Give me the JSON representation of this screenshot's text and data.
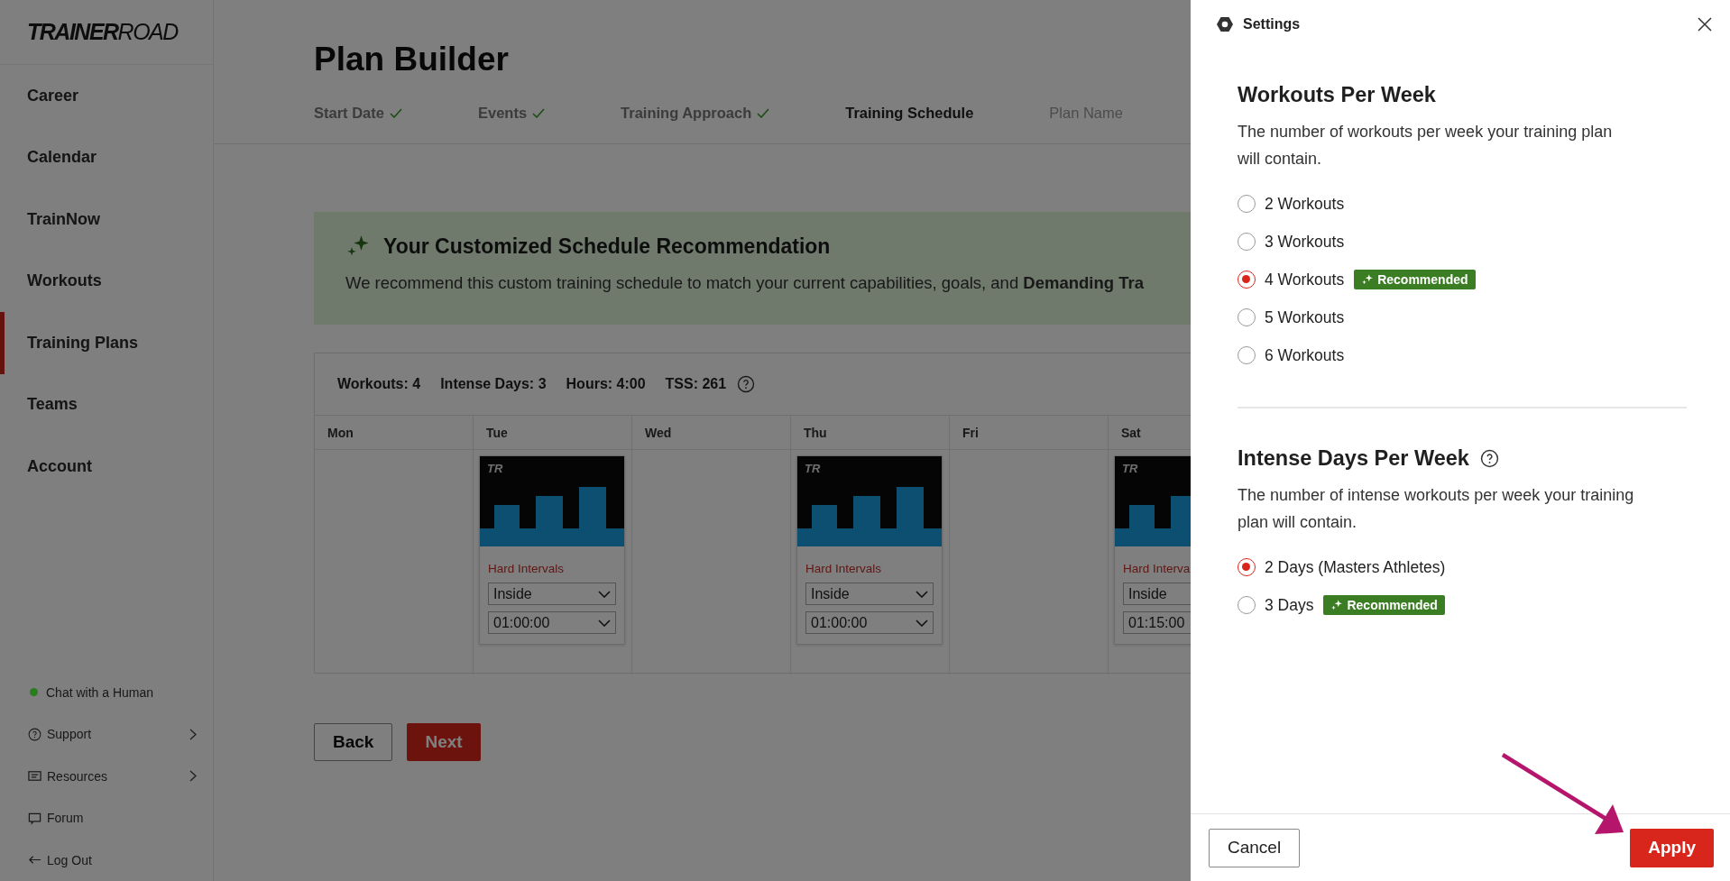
{
  "sidebar": {
    "logo": "**TRAINER**ROAD",
    "nav": [
      {
        "label": "Career",
        "selected": false
      },
      {
        "label": "Calendar",
        "selected": false
      },
      {
        "label": "TrainNow",
        "selected": false
      },
      {
        "label": "Workouts",
        "selected": false
      },
      {
        "label": "Training Plans",
        "selected": true
      },
      {
        "label": "Teams",
        "selected": false
      },
      {
        "label": "Account",
        "selected": false
      }
    ],
    "footer_links": [
      {
        "kind": "status",
        "label": "Chat with a Human",
        "color": "#2a7d1e",
        "has_submenu": false
      },
      {
        "kind": "help",
        "label": "Support",
        "has_submenu": true
      },
      {
        "kind": "resources",
        "label": "Resources",
        "has_submenu": true
      },
      {
        "kind": "forum",
        "label": "Forum",
        "has_submenu": false
      },
      {
        "kind": "logout",
        "label": "Log Out",
        "has_submenu": false
      }
    ]
  },
  "page": {
    "title": "Plan Builder",
    "steps": [
      {
        "label": "Start Date",
        "done": true,
        "selected": false
      },
      {
        "label": "Events",
        "done": true,
        "selected": false
      },
      {
        "label": "Training Approach",
        "done": true,
        "selected": false
      },
      {
        "label": "Training Schedule",
        "done": false,
        "selected": true
      },
      {
        "label": "Plan Name",
        "done": false,
        "selected": false
      }
    ],
    "banner": {
      "title": "Your Customized Schedule Recommendation",
      "text": "We recommend this custom training schedule to match your current capabilities, goals, and **Demanding Tra**"
    },
    "summary": [
      {
        "text": "Workouts: 4",
        "help": false
      },
      {
        "text": "Intense Days: 3",
        "help": false
      },
      {
        "text": "Hours: 4:00",
        "help": false
      },
      {
        "text": "TSS: 261",
        "help": true
      }
    ],
    "schedule": [
      {
        "day": "Mon"
      },
      {
        "day": "Tue",
        "workout": {
          "logo": "TR",
          "name": "Hard Intervals",
          "location": "Inside",
          "duration": "01:00:00"
        }
      },
      {
        "day": "Wed"
      },
      {
        "day": "Thu",
        "workout": {
          "logo": "TR",
          "name": "Hard Intervals",
          "location": "Inside",
          "duration": "01:00:00"
        }
      },
      {
        "day": "Fri"
      },
      {
        "day": "Sat",
        "workout": {
          "logo": "TR",
          "name": "Hard Interva",
          "location": "Inside",
          "duration": "01:15:00",
          "dropdown_arrows": false
        }
      }
    ],
    "buttons": {
      "back": "Back",
      "next": "Next"
    }
  },
  "settings": {
    "title": "Settings",
    "sections": [
      {
        "title": "Workouts Per Week",
        "help": false,
        "description": "The number of workouts per week your training plan will contain.",
        "options": [
          {
            "label": "2 Workouts",
            "selected": false
          },
          {
            "label": "3 Workouts",
            "selected": false
          },
          {
            "label": "4 Workouts",
            "selected": true,
            "badge": "Recommended"
          },
          {
            "label": "5 Workouts",
            "selected": false
          },
          {
            "label": "6 Workouts",
            "selected": false
          }
        ]
      },
      {
        "title": "Intense Days Per Week",
        "help": true,
        "description": "The number of intense workouts per week your training plan will contain.",
        "options": [
          {
            "label": "2 Days (Masters Athletes)",
            "selected": true
          },
          {
            "label": "3 Days",
            "selected": false,
            "badge": "Recommended"
          }
        ]
      }
    ],
    "cancel": "Cancel",
    "apply": "Apply"
  }
}
